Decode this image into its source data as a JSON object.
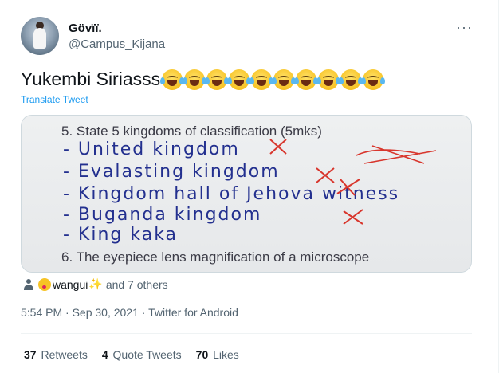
{
  "author": {
    "name": "Gövïï.",
    "handle": "@Campus_Kijana"
  },
  "menu": {
    "more_label": "···"
  },
  "tweet": {
    "text": "Yukembi Siriasss",
    "emoji_count": 10,
    "emoji_name": "face-with-tears-of-joy-icon",
    "translate_label": "Translate Tweet"
  },
  "media": {
    "question5": "5. State 5 kingdoms of classification (5mks)",
    "answers": [
      "- United kingdom",
      "- Evalasting kingdom",
      "- Kingdom hall of Jehova witness",
      "- Buganda kingdom",
      "- King kaka"
    ],
    "question6": "6. The eyepiece lens magnification of a microscope"
  },
  "liked_by": {
    "user": "wangui",
    "others": "and 7 others"
  },
  "timestamp": "5:54 PM · Sep 30, 2021 · Twitter for Android",
  "stats": {
    "retweets_count": "37",
    "retweets_label": "Retweets",
    "quotes_count": "4",
    "quotes_label": "Quote Tweets",
    "likes_count": "70",
    "likes_label": "Likes"
  },
  "colors": {
    "accent": "#1d9bf0",
    "text_secondary": "#536471",
    "ink": "#23308f",
    "red_pen": "#d8362d"
  }
}
